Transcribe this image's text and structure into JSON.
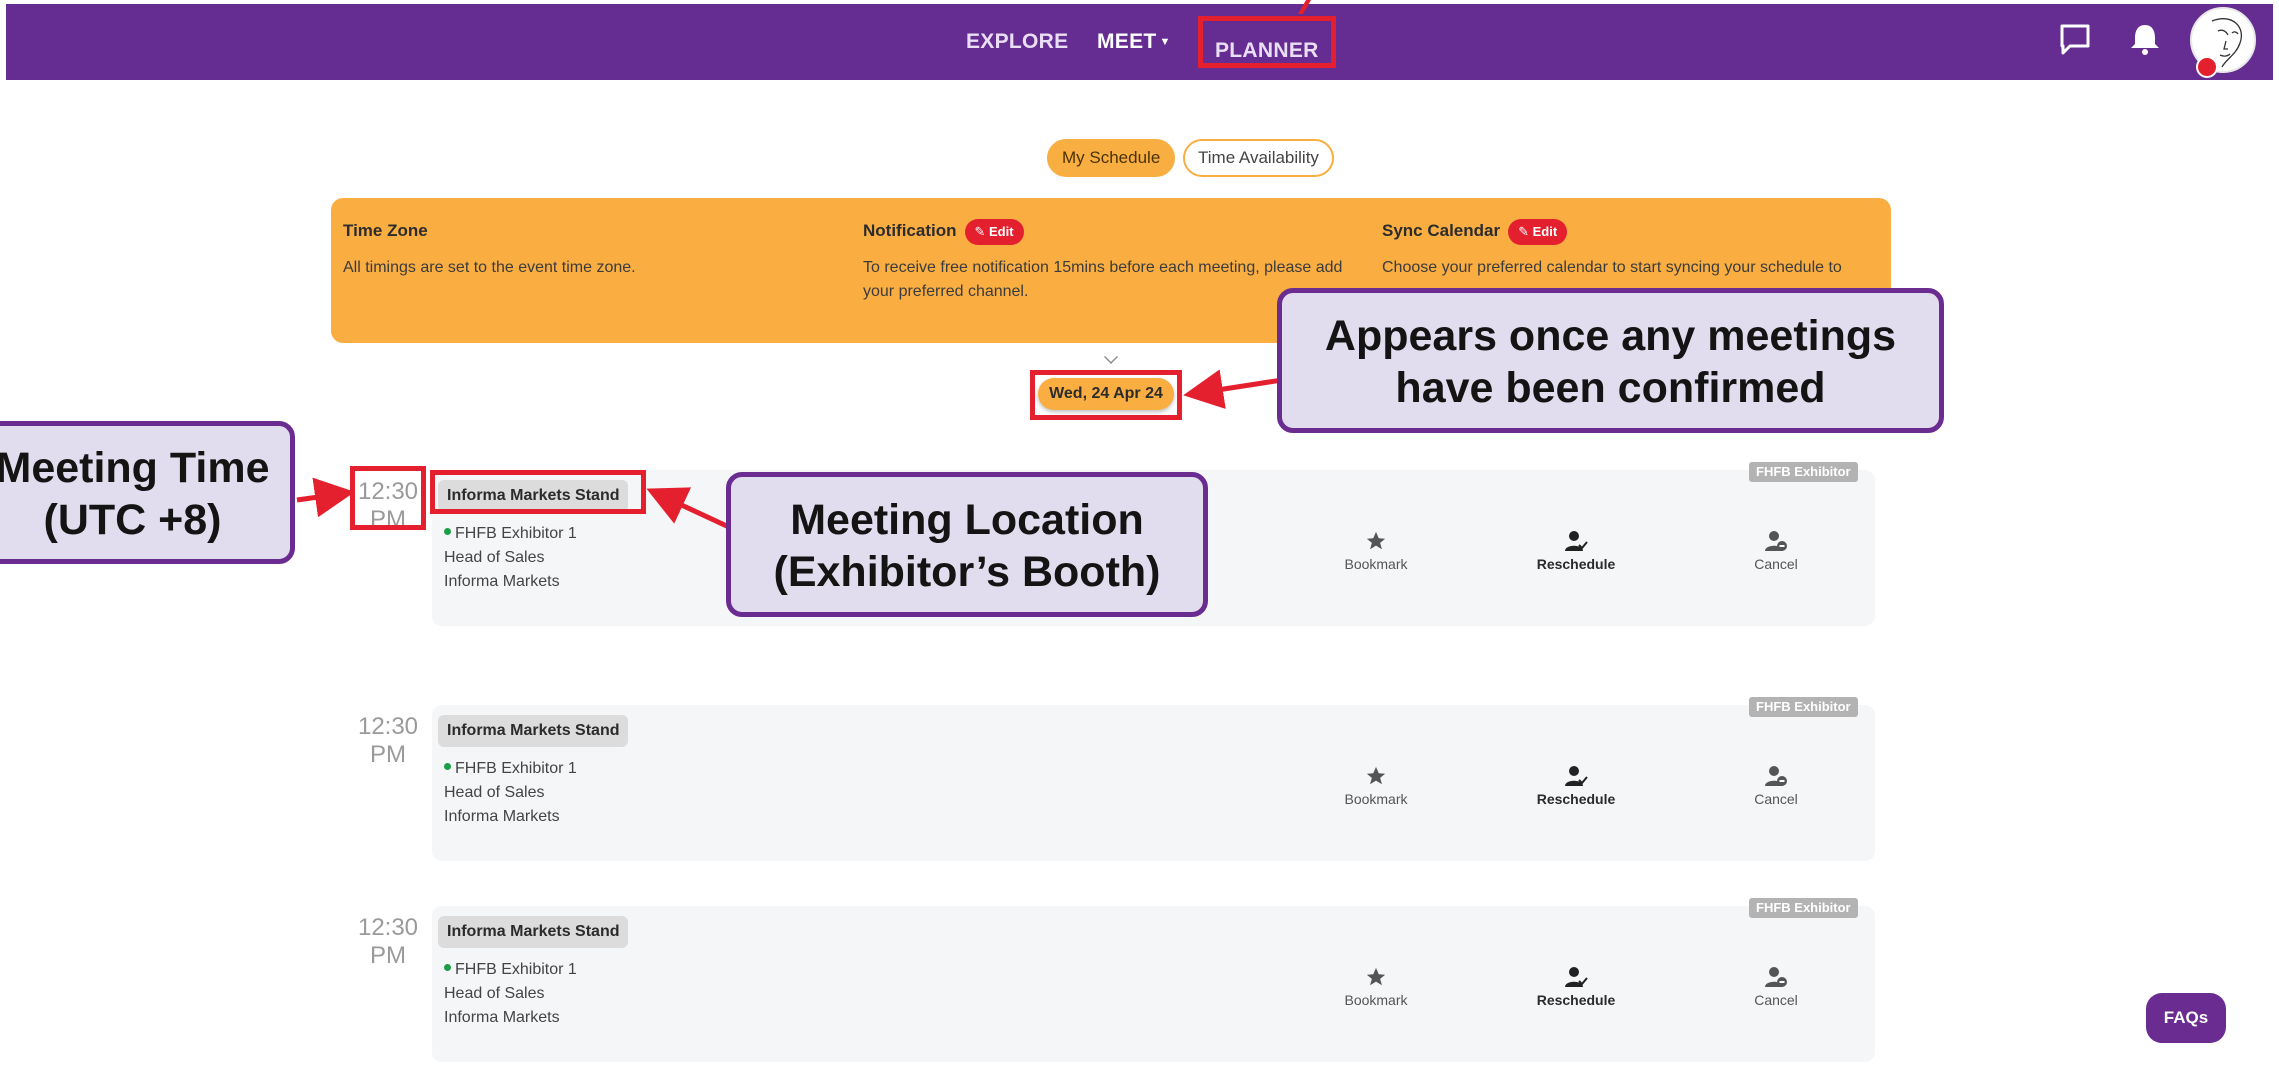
{
  "nav": {
    "explore": "EXPLORE",
    "meet": "MEET",
    "planner": "PLANNER",
    "brand_color": "#652c92"
  },
  "tabs": {
    "my_schedule": "My Schedule",
    "time_availability": "Time Availability"
  },
  "info": {
    "timezone_title": "Time Zone",
    "timezone_text": "All timings are set to the event time zone.",
    "notification_title": "Notification",
    "notification_text": "To receive free notification 15mins before each meeting, please add your preferred channel.",
    "sync_title": "Sync Calendar",
    "sync_text": "Choose your preferred calendar to start syncing your schedule to",
    "edit_label": "Edit",
    "panel_color": "#faae42"
  },
  "date_label": "Wed, 24 Apr 24",
  "meetings": [
    {
      "time_hour": "12:30",
      "time_period": "PM",
      "location": "Informa Markets Stand",
      "exhibitor": "FHFB Exhibitor 1",
      "role": "Head of Sales",
      "company": "Informa Markets",
      "tag": "FHFB Exhibitor",
      "bookmark": "Bookmark",
      "reschedule": "Reschedule",
      "cancel": "Cancel"
    },
    {
      "time_hour": "12:30",
      "time_period": "PM",
      "location": "Informa Markets Stand",
      "exhibitor": "FHFB Exhibitor 1",
      "role": "Head of Sales",
      "company": "Informa Markets",
      "tag": "FHFB Exhibitor",
      "bookmark": "Bookmark",
      "reschedule": "Reschedule",
      "cancel": "Cancel"
    },
    {
      "time_hour": "12:30",
      "time_period": "PM",
      "location": "Informa Markets Stand",
      "exhibitor": "FHFB Exhibitor 1",
      "role": "Head of Sales",
      "company": "Informa Markets",
      "tag": "FHFB Exhibitor",
      "bookmark": "Bookmark",
      "reschedule": "Reschedule",
      "cancel": "Cancel"
    }
  ],
  "callouts": {
    "meeting_time_line1": "Meeting Time",
    "meeting_time_line2": "(UTC +8)",
    "location_line1": "Meeting Location",
    "location_line2": "(Exhibitor’s Booth)",
    "appears_line1": "Appears once any meetings",
    "appears_line2": "have been confirmed"
  },
  "faq": "FAQs",
  "icons": {
    "chat": "chat-icon",
    "bell": "bell-icon",
    "bookmark": "star-icon",
    "reschedule": "person-check-icon",
    "cancel": "person-remove-icon"
  }
}
